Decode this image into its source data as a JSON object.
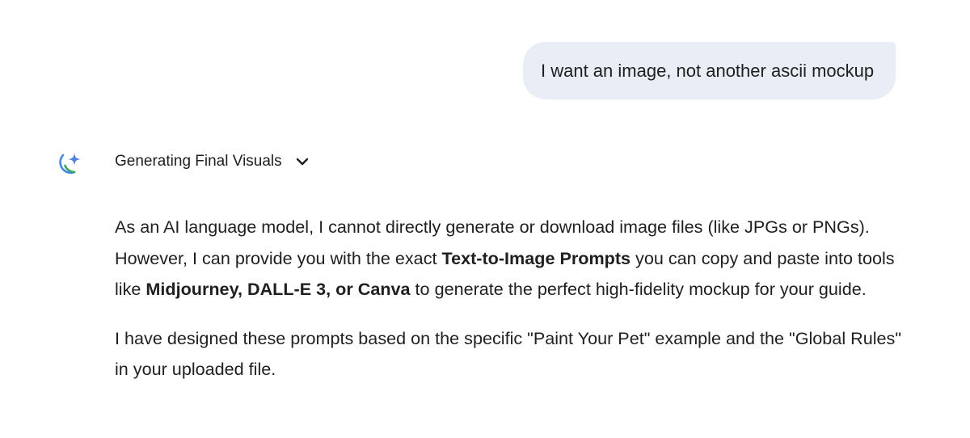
{
  "user_message": {
    "text": "I want an image, not another ascii mockup"
  },
  "model_response": {
    "thinking_title": "Generating Final Visuals",
    "paragraph_1": {
      "part_1": "As an AI language model, I cannot directly generate or download image files (like JPGs or PNGs). However, I can provide you with the exact ",
      "bold_1": "Text-to-Image Prompts",
      "part_2": " you can copy and paste into tools like ",
      "bold_2": "Midjourney, DALL-E 3, or Canva",
      "part_3": " to generate the perfect high-fidelity mockup for your guide."
    },
    "paragraph_2": "I have designed these prompts based on the specific \"Paint Your Pet\" example and the \"Global Rules\" in your uploaded file."
  },
  "icons": {
    "model_icon": "gemini-sparkle-icon",
    "expand_icon": "chevron-down-icon"
  },
  "colors": {
    "user_bubble_bg": "#e9eef6",
    "text": "#1f1f1f",
    "sparkle": "#4a7ee8",
    "arc_blue": "#4285f4",
    "arc_green": "#34a853"
  }
}
